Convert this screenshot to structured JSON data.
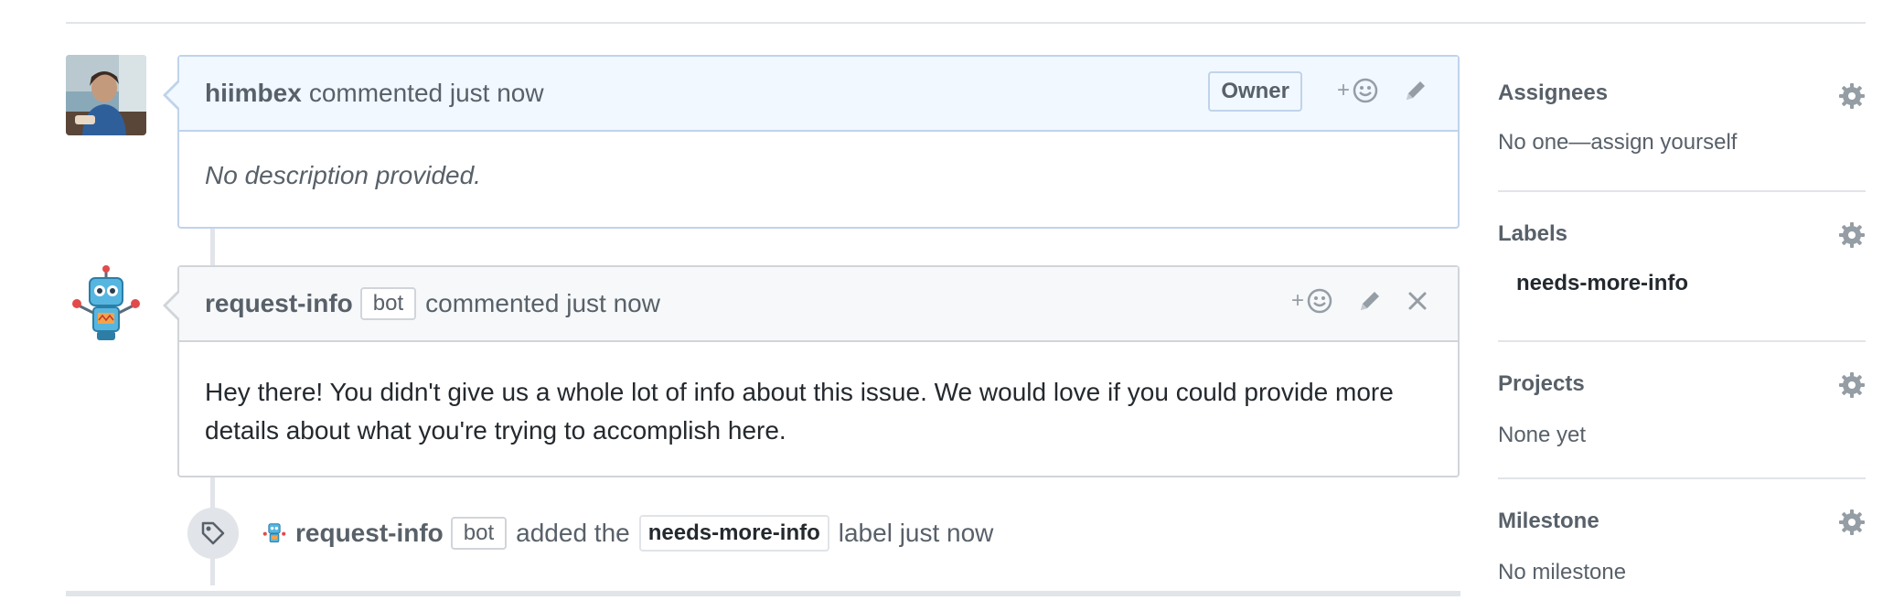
{
  "comments": [
    {
      "author": "hiimbex",
      "action": "commented just now",
      "badge": "Owner",
      "body": "No description provided."
    },
    {
      "author": "request-info",
      "bot_badge": "bot",
      "action": "commented just now",
      "body": "Hey there! You didn't give us a whole lot of info about this issue. We would love if you could provide more details about what you're trying to accomplish here."
    }
  ],
  "event": {
    "actor": "request-info",
    "bot_badge": "bot",
    "text_before": "added the",
    "label": "needs-more-info",
    "text_after": "label just now"
  },
  "reaction_plus": "+",
  "sidebar": {
    "assignees": {
      "title": "Assignees",
      "value": "No one—assign yourself"
    },
    "labels": {
      "title": "Labels",
      "value": "needs-more-info"
    },
    "projects": {
      "title": "Projects",
      "value": "None yet"
    },
    "milestone": {
      "title": "Milestone",
      "value": "No milestone"
    }
  },
  "icons": [
    "smiley-icon",
    "pencil-icon",
    "close-icon",
    "tag-icon",
    "gear-icon"
  ],
  "colors": {
    "owner_header_bg": "#f1f8ff",
    "owner_border": "#c0d3eb",
    "header_bg": "#f6f8fa",
    "border": "#d1d5da"
  }
}
